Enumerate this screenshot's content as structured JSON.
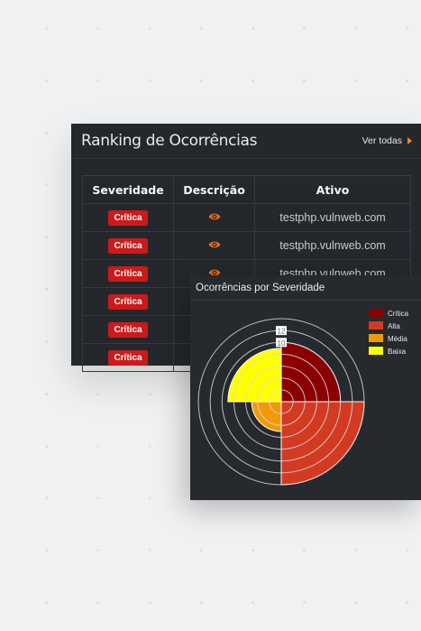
{
  "ranking": {
    "title": "Ranking de Ocorrências",
    "link_label": "Ver todas",
    "columns": [
      "Severidade",
      "Descrição",
      "Ativo"
    ],
    "rows": [
      {
        "severity": "Crítica",
        "asset": "testphp.vulnweb.com"
      },
      {
        "severity": "Crítica",
        "asset": "testphp.vulnweb.com"
      },
      {
        "severity": "Crítica",
        "asset": "testphp.vulnweb.com"
      },
      {
        "severity": "Crítica",
        "asset": ""
      },
      {
        "severity": "Crítica",
        "asset": ""
      },
      {
        "severity": "Crítica",
        "asset": ""
      }
    ],
    "colors": {
      "badge": "#cc1a1a",
      "eye": "#e26a1b",
      "accent": "#f08a24"
    }
  },
  "severity_chart": {
    "title": "Ocorrências por Severidade",
    "legend": [
      {
        "label": "Crítica",
        "color": "#8b0000"
      },
      {
        "label": "Alta",
        "color": "#d33a22"
      },
      {
        "label": "Média",
        "color": "#f09a0a"
      },
      {
        "label": "Baixa",
        "color": "#ffff00"
      }
    ]
  },
  "chart_data": {
    "type": "polar-area",
    "categories": [
      "Crítica",
      "Alta",
      "Média",
      "Baixa"
    ],
    "values": [
      10,
      14,
      5,
      9
    ],
    "ticks_shown": [
      10,
      12
    ],
    "r_max": 14,
    "grid": true,
    "legend_position": "top-right"
  }
}
